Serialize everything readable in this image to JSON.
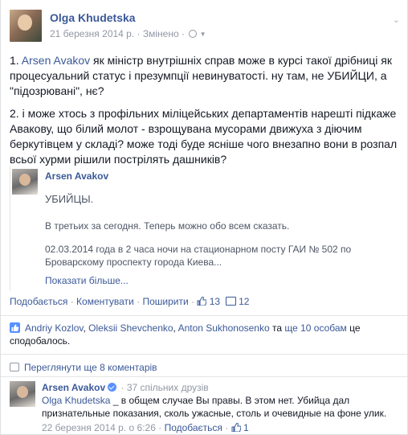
{
  "post": {
    "author": "Olga Khudetska",
    "date": "21 березня 2014 р.",
    "edited": "Змінено",
    "separator": "·",
    "paragraph1_prefix": "1. ",
    "paragraph1_mention": "Arsen Avakov",
    "paragraph1_text": " як міністр внутрішніх справ може в курсі такої дрібниці як процесуальний статус і презумпції невинуватості. ну там, не УБИЙЦИ, а \"підозрювані\", нє?",
    "paragraph2": "2. і може хтось з профільних міліцейських департаментів нарешті підкаже Авакову, що білий молот - взрощувана мусорами движуха з діючим беркутівцем у складі? може тоді буде ясніше чого внезапно вони в розпал всьої хурми рішили пострілять дашників?"
  },
  "shared_post": {
    "author": "Arsen Avakov",
    "line1": "УБИЙЦЫ.",
    "line2": "В третьих за сегодня. Теперь можно обо всем сказать.",
    "line3": "02.03.2014 года в 2 часа ночи на стационарном посту ГАИ № 502 по Броварскому проспекту города Киева...",
    "see_more": "Показати більше..."
  },
  "actions": {
    "like": "Подобається",
    "comment": "Коментувати",
    "share": "Поширити",
    "like_count": "13",
    "comment_count": "12",
    "sep": "·"
  },
  "likes": {
    "names": [
      "Andriy Kozlov",
      "Oleksii Shevchenko",
      "Anton Sukhonosenko"
    ],
    "comma": ", ",
    "and": " та ",
    "others": "ще 10 особам",
    "suffix": " це сподобалось."
  },
  "more_comments": "Переглянути ще 8 коментарів",
  "comment": {
    "author": "Arsen Avakov",
    "mutual": "· 37 спільних друзів",
    "mention": "Olga Khudetska",
    "text": " _ в общем случае Вы правы. В этом нет. Убийца дал признательные показания, сколь ужасные, столь и очевидные на фоне улик.",
    "date": "22 березня 2014 р. о 6:26",
    "like": "Подобається",
    "like_count": "1",
    "sep": "·"
  },
  "colors": {
    "link": "#3b5998",
    "meta": "#9197a3",
    "text": "#141823"
  }
}
